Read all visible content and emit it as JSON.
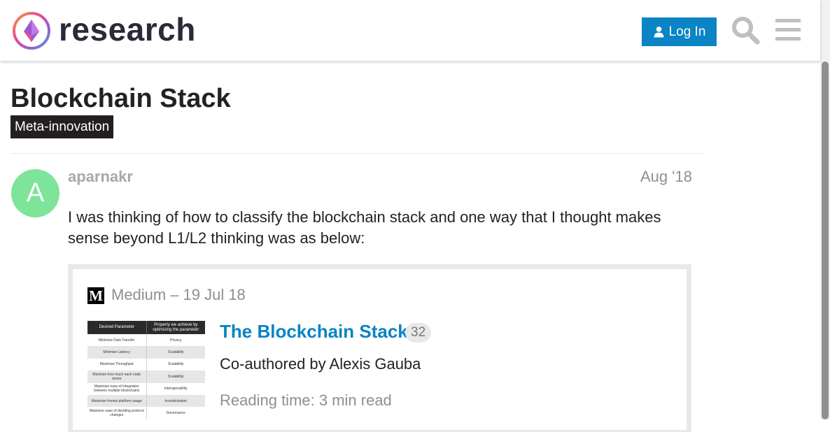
{
  "header": {
    "brand": "research",
    "login_label": "Log In",
    "icons": {
      "login": "user-icon",
      "search": "search-icon",
      "menu": "hamburger-menu-icon"
    },
    "colors": {
      "login_bg": "#0a84c4",
      "icon_gray": "#bfbfbf"
    }
  },
  "topic": {
    "title": "Blockchain Stack",
    "category": "Meta-innovation",
    "category_color": "#231f20"
  },
  "post": {
    "avatar_letter": "A",
    "avatar_color": "#7ee49a",
    "username": "aparnakr",
    "date": "Aug '18",
    "body": "I was thinking of how to classify the blockchain stack and one way that I thought makes sense beyond L1/L2 thinking was as below:"
  },
  "onebox": {
    "source_logo": "M",
    "source_name": "Medium",
    "source_sep": "–",
    "source_date": "19 Jul 18",
    "title": "The Blockchain Stack",
    "click_count": "32",
    "description": "Co-authored by Alexis Gauba",
    "reading_time": "Reading time: 3 min read",
    "thumbnail": {
      "headers": [
        "Desired Parameter",
        "Property we achieve by optimizing the parameter"
      ],
      "rows": [
        [
          "Minimize Data Transfer",
          "Privacy"
        ],
        [
          "Minimize Latency",
          "Scalability"
        ],
        [
          "Maximize Throughput",
          "Scalability"
        ],
        [
          "Minimize how much each node stores",
          "Scalability"
        ],
        [
          "Maximize ease of integration between multiple blockchains",
          "Interoperability"
        ],
        [
          "Maximize honest platform usage",
          "Incentivization"
        ],
        [
          "Maximize ease of deciding protocol changes",
          "Governance"
        ]
      ]
    }
  }
}
